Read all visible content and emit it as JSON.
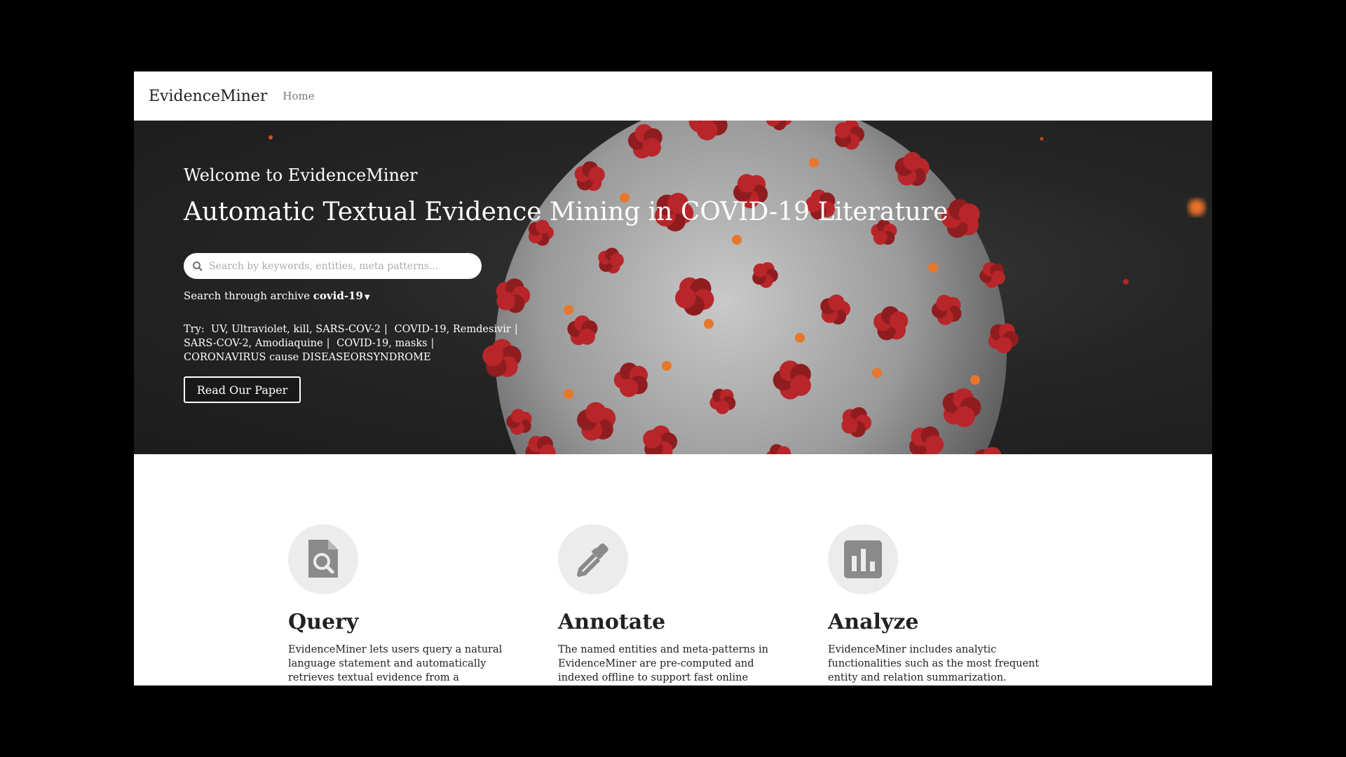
{
  "nav": {
    "brand": "EvidenceMiner",
    "home": "Home"
  },
  "hero": {
    "welcome": "Welcome to EvidenceMiner",
    "headline": "Automatic Textual Evidence Mining in COVID-19 Literature",
    "search_placeholder": "Search by keywords, entities, meta patterns...",
    "archive_prefix": "Search through archive ",
    "archive_value": "covid-19",
    "try_label": "Try:",
    "try_items": [
      "UV, Ultraviolet, kill, SARS-COV-2",
      "COVID-19, Remdesivir",
      "SARS-COV-2, Amodiaquine",
      "COVID-19, masks",
      "CORONAVIRUS cause DISEASEORSYNDROME"
    ],
    "paper_button": "Read Our Paper"
  },
  "features": [
    {
      "icon": "document-search-icon",
      "title": "Query",
      "desc": "EvidenceMiner lets users query a natural language statement and automatically retrieves textual evidence from a background"
    },
    {
      "icon": "eyedropper-icon",
      "title": "Annotate",
      "desc": "The named entities and meta-patterns in EvidenceMiner are pre-computed and indexed offline to support fast online evidence"
    },
    {
      "icon": "bar-chart-icon",
      "title": "Analyze",
      "desc": "EvidenceMiner includes analytic functionalities such as the most frequent entity and relation summarization."
    }
  ],
  "colors": {
    "virus_spike": "#b8262a",
    "virus_body": "#8f8f8f",
    "icon_gray": "#8a8a8a"
  }
}
